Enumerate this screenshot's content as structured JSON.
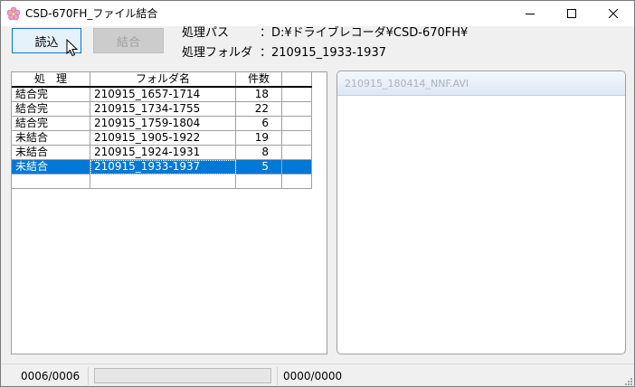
{
  "window": {
    "title": "CSD-670FH_ファイル結合"
  },
  "toolbar": {
    "read_label": "読込",
    "combine_label": "結合"
  },
  "info": {
    "path_label": "処理パス",
    "path_value": "：D:¥ドライブレコーダ¥CSD-670FH¥",
    "folder_label": "処理フォルダ",
    "folder_value": "：210915_1933-1937"
  },
  "grid": {
    "headers": [
      "処　理",
      "フォルダ名",
      "件数",
      ""
    ],
    "rows": [
      {
        "status": "結合完",
        "folder": "210915_1657-1714",
        "count": "18"
      },
      {
        "status": "結合完",
        "folder": "210915_1734-1755",
        "count": "22"
      },
      {
        "status": "結合完",
        "folder": "210915_1759-1804",
        "count": "6"
      },
      {
        "status": "未結合",
        "folder": "210915_1905-1922",
        "count": "19"
      },
      {
        "status": "未結合",
        "folder": "210915_1924-1931",
        "count": "8"
      },
      {
        "status": "未結合",
        "folder": "210915_1933-1937",
        "count": "5"
      }
    ],
    "selected_row": 5
  },
  "file_panel": {
    "item": "210915_180414_NNF.AVI"
  },
  "status": {
    "folder_progress": "0006/0006",
    "file_progress": "0000/0000",
    "progress_fraction": 0
  },
  "colors": {
    "selection": "#0078d7",
    "accent_border": "#0078d7"
  }
}
